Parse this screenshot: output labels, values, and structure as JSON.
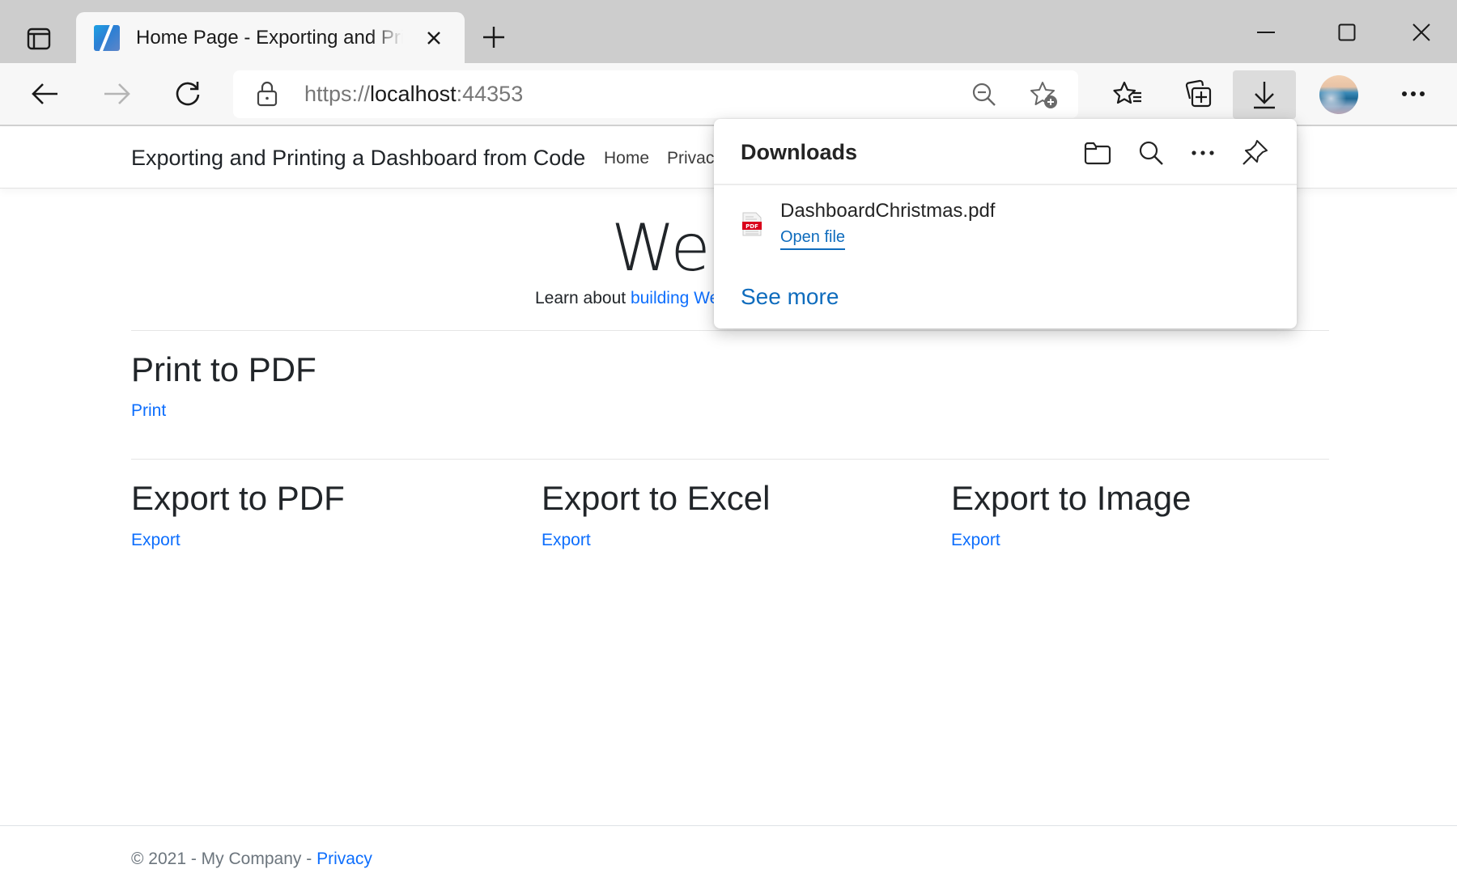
{
  "browser": {
    "tab": {
      "title": "Home Page - Exporting and Printing a Dashboard from Code",
      "favicon": "app-favicon"
    },
    "address_bar": {
      "scheme": "https://",
      "host": "localhost",
      "port": ":44353"
    },
    "toolbar_icons": [
      "back-icon",
      "forward-icon",
      "refresh-icon",
      "lock-icon",
      "zoom-out-icon",
      "add-favorite-icon",
      "favorites-icon",
      "collections-icon",
      "downloads-icon",
      "profile-avatar",
      "more-icon"
    ],
    "window_controls": [
      "minimize-icon",
      "maximize-icon",
      "close-icon"
    ]
  },
  "site": {
    "brand": "Exporting and Printing a Dashboard from Code",
    "nav": [
      {
        "label": "Home"
      },
      {
        "label": "Privacy"
      }
    ],
    "hero": {
      "title": "Welcome",
      "subtitle_prefix": "Learn about ",
      "subtitle_link": "building Web apps with ASP.NET Core"
    },
    "sections": [
      {
        "title": "Print to PDF",
        "link": "Print"
      },
      {
        "title": "Export to PDF",
        "link": "Export"
      },
      {
        "title": "Export to Excel",
        "link": "Export"
      },
      {
        "title": "Export to Image",
        "link": "Export"
      }
    ],
    "footer": {
      "text": "© 2021 - My Company - ",
      "link": "Privacy"
    }
  },
  "downloads_panel": {
    "title": "Downloads",
    "header_icons": [
      "open-folder-icon",
      "search-icon",
      "more-options-icon",
      "pin-icon"
    ],
    "items": [
      {
        "filename": "DashboardChristmas.pdf",
        "action": "Open file",
        "file_type": "PDF"
      }
    ],
    "see_more": "See more"
  },
  "colors": {
    "link": "#0d6efd",
    "edge_accent": "#0f6cbd",
    "tabbar_bg": "#cdcdcd",
    "toolbar_bg": "#f7f7f7",
    "pdf_red": "#d9001b"
  }
}
